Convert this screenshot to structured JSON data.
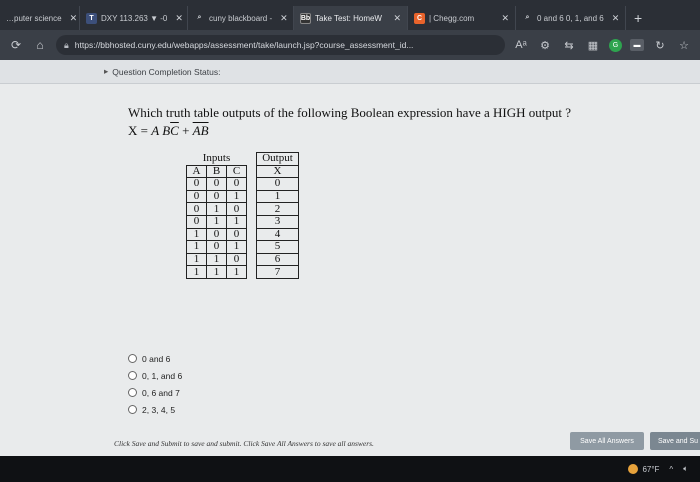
{
  "browser": {
    "tabs": [
      {
        "title": "…puter science",
        "icon": "",
        "color": "#2b2f36"
      },
      {
        "title": "DXY 113.263 ▼ -0",
        "icon": "T",
        "color": "#3c4f7a"
      },
      {
        "title": "cuny blackboard - ",
        "icon": "⌕",
        "color": "#2b2f36"
      },
      {
        "title": "Take Test: HomeW",
        "icon": "Bb",
        "color": "#333"
      },
      {
        "title": "| Chegg.com",
        "icon": "C",
        "color": "#e8632b"
      },
      {
        "title": "0 and 6 0, 1, and 6",
        "icon": "⌕",
        "color": "#2b2f36"
      }
    ],
    "url": "https://bbhosted.cuny.edu/webapps/assessment/take/launch.jsp?course_assessment_id..."
  },
  "status": {
    "label": "Question Completion Status:"
  },
  "question": {
    "text": "Which truth table outputs of the following Boolean expression have a HIGH output ?",
    "expr_lhs": "X = ",
    "expr_t1": "ABC",
    "expr_plus": " + ",
    "expr_t2": "AB"
  },
  "truth_table": {
    "group_inputs": "Inputs",
    "group_output": "Output",
    "headers": [
      "A",
      "B",
      "C",
      "X"
    ],
    "rows": [
      [
        "0",
        "0",
        "0",
        "0"
      ],
      [
        "0",
        "0",
        "1",
        "1"
      ],
      [
        "0",
        "1",
        "0",
        "2"
      ],
      [
        "0",
        "1",
        "1",
        "3"
      ],
      [
        "1",
        "0",
        "0",
        "4"
      ],
      [
        "1",
        "0",
        "1",
        "5"
      ],
      [
        "1",
        "1",
        "0",
        "6"
      ],
      [
        "1",
        "1",
        "1",
        "7"
      ]
    ]
  },
  "options": [
    "0 and 6",
    "0, 1, and 6",
    "0, 6 and 7",
    "2, 3, 4, 5"
  ],
  "footer": {
    "instruction": "Click Save and Submit to save and submit. Click Save All Answers to save all answers.",
    "save_all": "Save All Answers",
    "save_submit": "Save and Su"
  },
  "taskbar": {
    "temperature": "67°F"
  }
}
